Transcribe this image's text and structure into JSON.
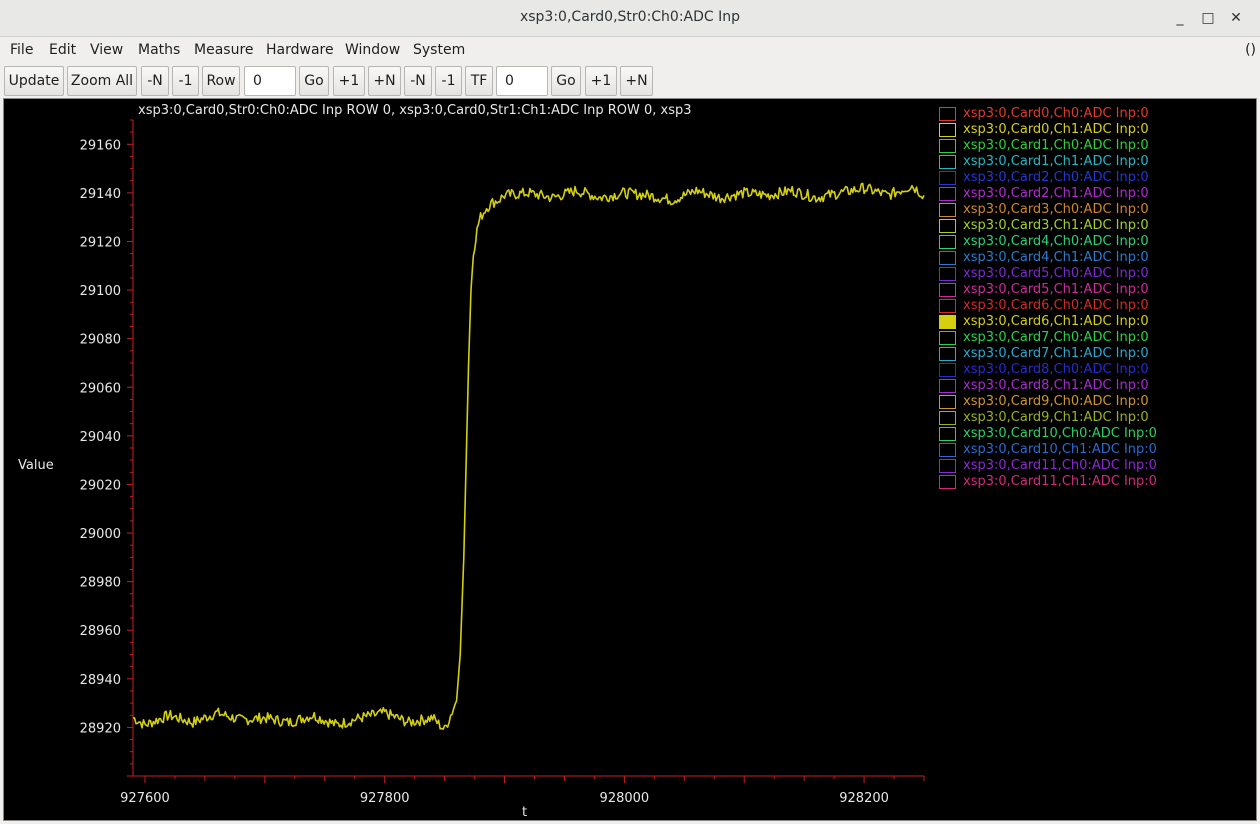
{
  "window": {
    "title": "xsp3:0,Card0,Str0:Ch0:ADC Inp",
    "minimize_glyph": "_",
    "maximize_glyph": "□",
    "close_glyph": "✕"
  },
  "menubar": {
    "items": [
      "File",
      "Edit",
      "View",
      "Maths",
      "Measure",
      "Hardware",
      "Window",
      "System"
    ],
    "right_text": "()"
  },
  "toolbar": {
    "update": "Update",
    "zoom_all": "Zoom All",
    "minus_n_1": "-N",
    "minus_1_1": "-1",
    "row": "Row",
    "row_value": "0",
    "go_1": "Go",
    "plus_1_1": "+1",
    "plus_n_1": "+N",
    "minus_n_2": "-N",
    "minus_1_2": "-1",
    "tf": "TF",
    "tf_value": "0",
    "go_2": "Go",
    "plus_1_2": "+1",
    "plus_n_2": "+N"
  },
  "chart_data": {
    "type": "line",
    "title": "xsp3:0,Card0,Str0:Ch0:ADC Inp ROW 0, xsp3:0,Card0,Str1:Ch1:ADC Inp ROW 0, xsp3",
    "xlabel": "t",
    "ylabel": "Value",
    "xlim": [
      927590,
      928250
    ],
    "ylim": [
      28900,
      29170
    ],
    "x_ticks": [
      "927600",
      "927800",
      "928000",
      "928200"
    ],
    "y_ticks": [
      "28920",
      "28940",
      "28960",
      "28980",
      "29000",
      "29020",
      "29040",
      "29060",
      "29080",
      "29100",
      "29120",
      "29140",
      "29160"
    ],
    "series": [
      {
        "name": "xsp3:0,Card6,Ch1:ADC Inp:0",
        "color": "#d4d010",
        "x": [
          927590,
          927600,
          927620,
          927640,
          927660,
          927680,
          927700,
          927720,
          927740,
          927760,
          927780,
          927800,
          927820,
          927840,
          927850,
          927855,
          927860,
          927863,
          927866,
          927868,
          927870,
          927872,
          927874,
          927876,
          927878,
          927880,
          927885,
          927890,
          927895,
          927900,
          927920,
          927940,
          927960,
          927980,
          928000,
          928020,
          928040,
          928060,
          928080,
          928100,
          928120,
          928140,
          928160,
          928180,
          928200,
          928220,
          928240,
          928250
        ],
        "y": [
          28924,
          28921,
          28925,
          28922,
          28926,
          28923,
          28924,
          28922,
          28925,
          28921,
          28924,
          28926,
          28922,
          28924,
          28919,
          28925,
          28931,
          28950,
          28990,
          29030,
          29070,
          29100,
          29115,
          29122,
          29127,
          29130,
          29134,
          29136,
          29137,
          29139,
          29140,
          29138,
          29141,
          29138,
          29140,
          29139,
          29137,
          29141,
          29138,
          29140,
          29139,
          29141,
          29138,
          29140,
          29142,
          29139,
          29143,
          29139
        ]
      }
    ]
  },
  "legend": {
    "entries": [
      {
        "label": "xsp3:0,Card0,Ch0:ADC Inp:0",
        "color": "#e03a2a",
        "filled": false
      },
      {
        "label": "xsp3:0,Card0,Ch1:ADC Inp:0",
        "color": "#d7d117",
        "filled": false
      },
      {
        "label": "xsp3:0,Card1,Ch0:ADC Inp:0",
        "color": "#2fd13a",
        "filled": false
      },
      {
        "label": "xsp3:0,Card1,Ch1:ADC Inp:0",
        "color": "#24b8c4",
        "filled": false
      },
      {
        "label": "xsp3:0,Card2,Ch0:ADC Inp:0",
        "color": "#2437d0",
        "filled": false
      },
      {
        "label": "xsp3:0,Card2,Ch1:ADC Inp:0",
        "color": "#b02ad2",
        "filled": false
      },
      {
        "label": "xsp3:0,Card3,Ch0:ADC Inp:0",
        "color": "#d1862a",
        "filled": false
      },
      {
        "label": "xsp3:0,Card3,Ch1:ADC Inp:0",
        "color": "#a6d124",
        "filled": false
      },
      {
        "label": "xsp3:0,Card4,Ch0:ADC Inp:0",
        "color": "#2ad17c",
        "filled": false
      },
      {
        "label": "xsp3:0,Card4,Ch1:ADC Inp:0",
        "color": "#2a7ad1",
        "filled": false
      },
      {
        "label": "xsp3:0,Card5,Ch0:ADC Inp:0",
        "color": "#7a2ad1",
        "filled": false
      },
      {
        "label": "xsp3:0,Card5,Ch1:ADC Inp:0",
        "color": "#d12a9a",
        "filled": false
      },
      {
        "label": "xsp3:0,Card6,Ch0:ADC Inp:0",
        "color": "#d12a2a",
        "filled": false
      },
      {
        "label": "xsp3:0,Card6,Ch1:ADC Inp:0",
        "color": "#d4d010",
        "filled": true
      },
      {
        "label": "xsp3:0,Card7,Ch0:ADC Inp:0",
        "color": "#2ad14a",
        "filled": false
      },
      {
        "label": "xsp3:0,Card7,Ch1:ADC Inp:0",
        "color": "#2aa9d1",
        "filled": false
      },
      {
        "label": "xsp3:0,Card8,Ch0:ADC Inp:0",
        "color": "#2a2ad1",
        "filled": false
      },
      {
        "label": "xsp3:0,Card8,Ch1:ADC Inp:0",
        "color": "#a82ad1",
        "filled": false
      },
      {
        "label": "xsp3:0,Card9,Ch0:ADC Inp:0",
        "color": "#d1962a",
        "filled": false
      },
      {
        "label": "xsp3:0,Card9,Ch1:ADC Inp:0",
        "color": "#9bb11f",
        "filled": false
      },
      {
        "label": "xsp3:0,Card10,Ch0:ADC Inp:0",
        "color": "#2ad16a",
        "filled": false
      },
      {
        "label": "xsp3:0,Card10,Ch1:ADC Inp:0",
        "color": "#2a6ad1",
        "filled": false
      },
      {
        "label": "xsp3:0,Card11,Ch0:ADC Inp:0",
        "color": "#8a2ad1",
        "filled": false
      },
      {
        "label": "xsp3:0,Card11,Ch1:ADC Inp:0",
        "color": "#d12a7a",
        "filled": false
      }
    ]
  }
}
